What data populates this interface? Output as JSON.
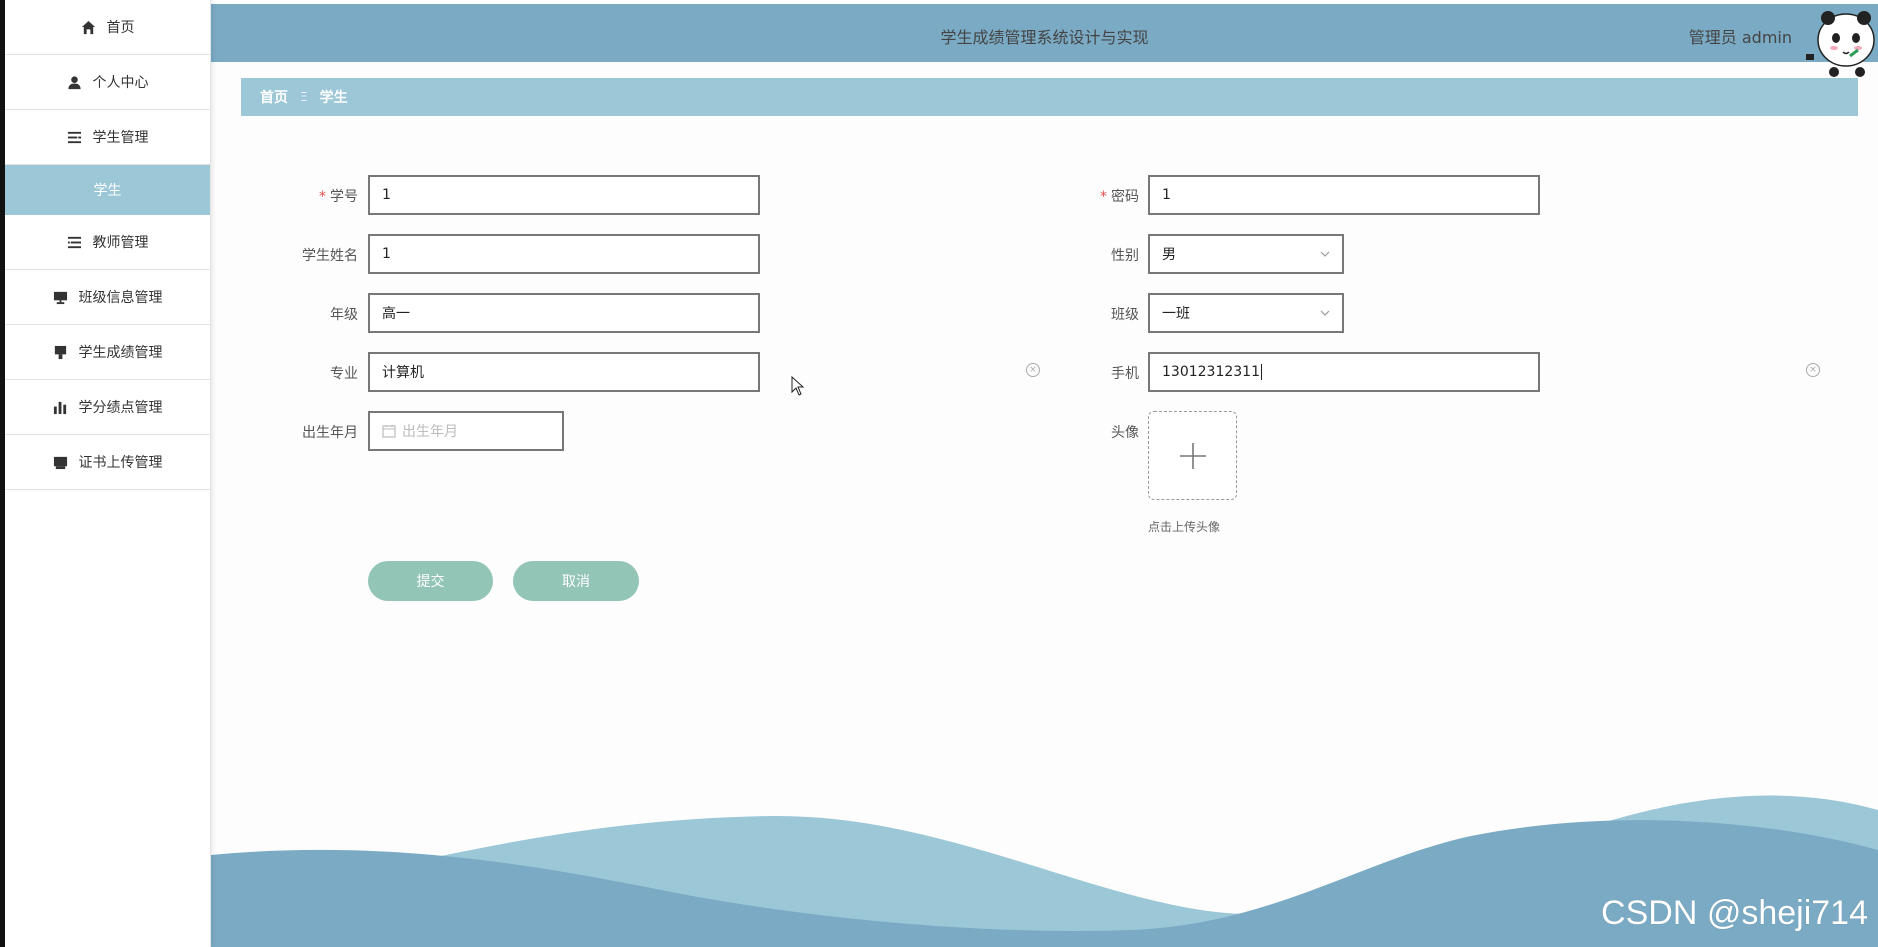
{
  "app": {
    "title": "学生成绩管理系统设计与实现",
    "user": "管理员 admin"
  },
  "sidebar": {
    "items": [
      {
        "label": "首页",
        "icon": "home-icon"
      },
      {
        "label": "个人中心",
        "icon": "user-icon"
      },
      {
        "label": "学生管理",
        "icon": "list-icon"
      },
      {
        "label": "学生",
        "icon": ""
      },
      {
        "label": "教师管理",
        "icon": "list-icon"
      },
      {
        "label": "班级信息管理",
        "icon": "monitor-icon"
      },
      {
        "label": "学生成绩管理",
        "icon": "monitor-icon"
      },
      {
        "label": "学分绩点管理",
        "icon": "bar-chart-icon"
      },
      {
        "label": "证书上传管理",
        "icon": "monitor-icon"
      }
    ]
  },
  "breadcrumb": {
    "home": "首页",
    "separator": "Ξ",
    "current": "学生"
  },
  "form": {
    "student_no": {
      "label": "学号",
      "value": "1",
      "required": true
    },
    "password": {
      "label": "密码",
      "value": "1",
      "required": true
    },
    "name": {
      "label": "学生姓名",
      "value": "1"
    },
    "gender": {
      "label": "性别",
      "value": "男"
    },
    "grade": {
      "label": "年级",
      "value": "高一"
    },
    "class": {
      "label": "班级",
      "value": "一班"
    },
    "major": {
      "label": "专业",
      "value": "计算机"
    },
    "phone": {
      "label": "手机",
      "value": "13012312311"
    },
    "birth": {
      "label": "出生年月",
      "placeholder": "出生年月"
    },
    "avatar": {
      "label": "头像",
      "tip": "点击上传头像"
    }
  },
  "buttons": {
    "submit": "提交",
    "cancel": "取消"
  },
  "watermark": "CSDN @sheji714",
  "colors": {
    "header": "#7aaac4",
    "breadcrumb": "#9bc7d7",
    "button": "#93c5b6",
    "required": "#e24b4b"
  }
}
